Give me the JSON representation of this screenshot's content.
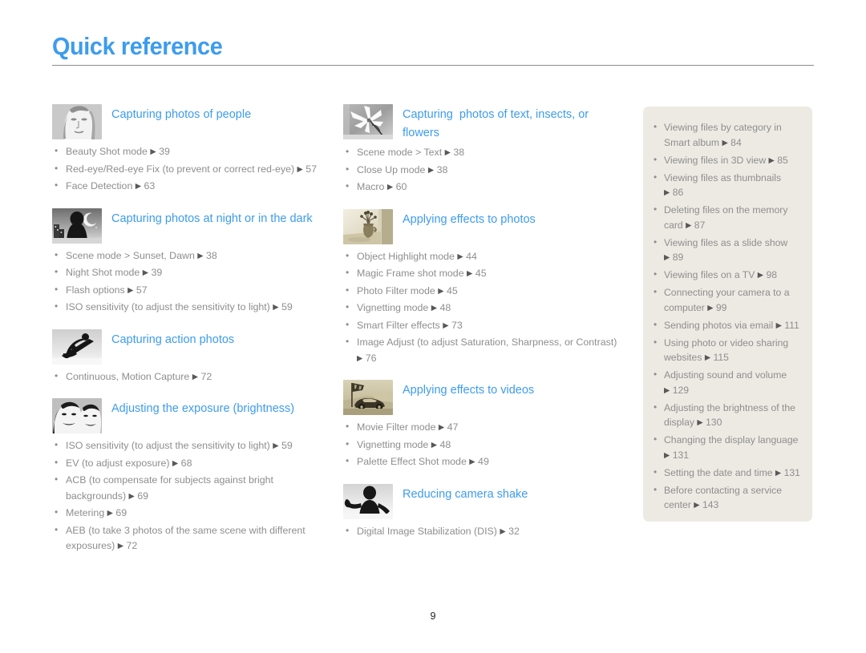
{
  "header": {
    "title": "Quick reference"
  },
  "footer": {
    "page_number": "9"
  },
  "colors": {
    "accent_blue": "#3d9ced",
    "body_gray": "#8e8e8e",
    "panel_bg": "#edeae3",
    "rule_gray": "#8c8c8c"
  },
  "left_column": [
    {
      "icon": "portrait-face-thumbnail",
      "title": "Capturing photos of people",
      "items": [
        {
          "text": "Beauty Shot mode",
          "arrow": "▶",
          "page": "39"
        },
        {
          "text": "Red-eye/Red-eye Fix (to prevent or correct red-eye)",
          "arrow": "▶",
          "page": "57"
        },
        {
          "text": "Face Detection",
          "arrow": "▶",
          "page": "63"
        }
      ]
    },
    {
      "icon": "night-scene-thumbnail",
      "title": "Capturing photos at night or in the dark",
      "items": [
        {
          "text": "Scene mode > Sunset, Dawn",
          "arrow": "▶",
          "page": "38"
        },
        {
          "text": "Night Shot mode",
          "arrow": "▶",
          "page": "39"
        },
        {
          "text": "Flash options",
          "arrow": "▶",
          "page": "57"
        },
        {
          "text": "ISO sensitivity (to adjust the sensitivity to light)",
          "arrow": "▶",
          "page": "59"
        }
      ]
    },
    {
      "icon": "snowboarder-action-thumbnail",
      "title": "Capturing action photos",
      "items": [
        {
          "text": "Continuous, Motion Capture",
          "arrow": "▶",
          "page": "72"
        }
      ]
    },
    {
      "icon": "two-faces-exposure-thumbnail",
      "title": "Adjusting the exposure (brightness)",
      "items": [
        {
          "text": "ISO sensitivity (to adjust the sensitivity to light)",
          "arrow": "▶",
          "page": "59"
        },
        {
          "text": "EV (to adjust exposure)",
          "arrow": "▶",
          "page": "68"
        },
        {
          "text": "ACB (to compensate for subjects against bright backgrounds)",
          "arrow": "▶",
          "page": "69"
        },
        {
          "text": "Metering",
          "arrow": "▶",
          "page": "69"
        },
        {
          "text": "AEB (to take 3 photos of the same scene with different exposures)",
          "arrow": "▶",
          "page": "72"
        }
      ]
    }
  ],
  "middle_column": [
    {
      "icon": "white-flower-macro-thumbnail",
      "title": "Capturing  photos of text, insects, or flowers",
      "items": [
        {
          "text": "Scene mode > Text",
          "arrow": "▶",
          "page": "38"
        },
        {
          "text": "Close Up mode",
          "arrow": "▶",
          "page": "38"
        },
        {
          "text": "Macro",
          "arrow": "▶",
          "page": "60"
        }
      ]
    },
    {
      "icon": "sepia-vase-flowers-thumbnail",
      "title": "Applying effects to photos",
      "items": [
        {
          "text": "Object Highlight mode",
          "arrow": "▶",
          "page": "44"
        },
        {
          "text": "Magic Frame shot mode",
          "arrow": "▶",
          "page": "45"
        },
        {
          "text": "Photo Filter mode",
          "arrow": "▶",
          "page": "45"
        },
        {
          "text": "Vignetting mode",
          "arrow": "▶",
          "page": "48"
        },
        {
          "text": "Smart Filter effects",
          "arrow": "▶",
          "page": "73"
        },
        {
          "text": "Image Adjust (to adjust Saturation, Sharpness, or Contrast)",
          "arrow": "▶",
          "page": "76"
        }
      ]
    },
    {
      "icon": "sepia-race-car-thumbnail",
      "title": "Applying effects to videos",
      "items": [
        {
          "text": "Movie Filter mode",
          "arrow": "▶",
          "page": "47"
        },
        {
          "text": "Vignetting mode",
          "arrow": "▶",
          "page": "48"
        },
        {
          "text": "Palette Effect Shot mode",
          "arrow": "▶",
          "page": "49"
        }
      ]
    },
    {
      "icon": "camera-shake-person-thumbnail",
      "title": "Reducing camera shake",
      "items": [
        {
          "text": "Digital Image Stabilization (DIS)",
          "arrow": "▶",
          "page": "32"
        }
      ]
    }
  ],
  "right_panel": {
    "items": [
      {
        "text": "Viewing files by category in Smart album",
        "arrow": "▶",
        "page": "84"
      },
      {
        "text": "Viewing files in 3D view",
        "arrow": "▶",
        "page": "85"
      },
      {
        "text": "Viewing files as thumbnails",
        "arrow": "▶",
        "page": "86"
      },
      {
        "text": "Deleting files on the memory card",
        "arrow": "▶",
        "page": "87"
      },
      {
        "text": "Viewing files as a slide show",
        "arrow": "▶",
        "page": "89"
      },
      {
        "text": "Viewing files on a TV",
        "arrow": "▶",
        "page": "98"
      },
      {
        "text": "Connecting your camera to a computer",
        "arrow": "▶",
        "page": "99"
      },
      {
        "text": "Sending photos via email",
        "arrow": "▶",
        "page": "111"
      },
      {
        "text": "Using photo or video sharing websites",
        "arrow": "▶",
        "page": "115"
      },
      {
        "text": "Adjusting sound and volume",
        "arrow": "▶",
        "page": "129"
      },
      {
        "text": "Adjusting the brightness of the display",
        "arrow": "▶",
        "page": "130"
      },
      {
        "text": "Changing the display language",
        "arrow": "▶",
        "page": "131"
      },
      {
        "text": "Setting the date and time",
        "arrow": "▶",
        "page": "131"
      },
      {
        "text": "Before contacting a service center",
        "arrow": "▶",
        "page": "143"
      }
    ]
  }
}
